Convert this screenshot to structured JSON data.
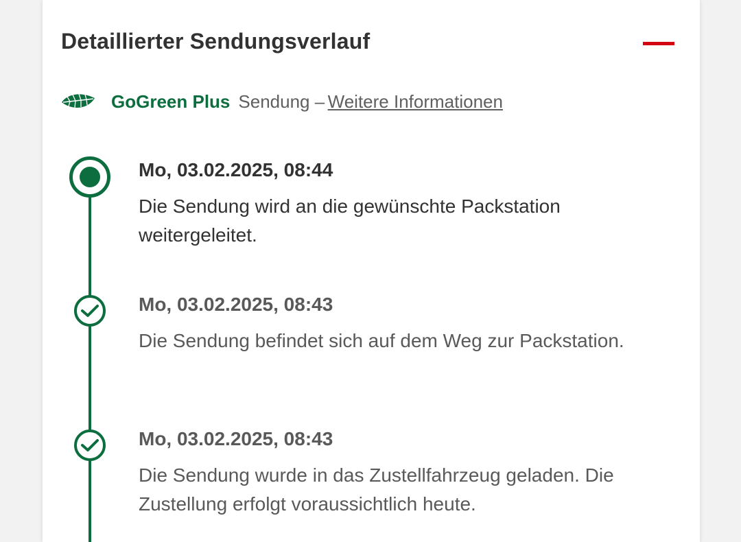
{
  "section": {
    "title": "Detaillierter Sendungsverlauf",
    "collapse_icon": "minus-icon",
    "accent_color": "#d40511"
  },
  "gogreen": {
    "icon": "leaf-icon",
    "label": "GoGreen Plus",
    "text": "Sendung –",
    "link": "Weitere Informationen",
    "color": "#0c6e3f"
  },
  "timeline": {
    "line_color": "#0c6e3f",
    "events": [
      {
        "status": "current",
        "date": "Mo, 03.02.2025, 08:44",
        "text": "Die Sendung wird an die gewünschte Packstation weitergeleitet."
      },
      {
        "status": "done",
        "date": "Mo, 03.02.2025, 08:43",
        "text": "Die Sendung befindet sich auf dem Weg zur Packstation."
      },
      {
        "status": "done",
        "date": "Mo, 03.02.2025, 08:43",
        "text": "Die Sendung wurde in das Zustellfahrzeug geladen. Die Zustellung erfolgt voraussichtlich heute."
      }
    ]
  }
}
